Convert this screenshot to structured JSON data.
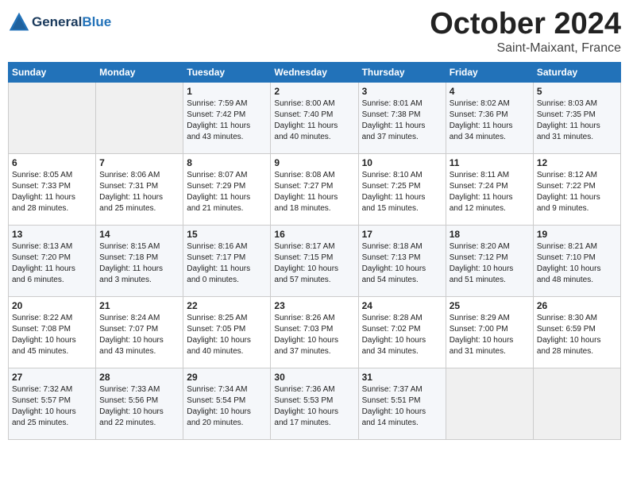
{
  "header": {
    "logo_line1": "General",
    "logo_line2": "Blue",
    "month": "October 2024",
    "location": "Saint-Maixant, France"
  },
  "weekdays": [
    "Sunday",
    "Monday",
    "Tuesday",
    "Wednesday",
    "Thursday",
    "Friday",
    "Saturday"
  ],
  "weeks": [
    [
      {
        "day": "",
        "info": ""
      },
      {
        "day": "",
        "info": ""
      },
      {
        "day": "1",
        "info": "Sunrise: 7:59 AM\nSunset: 7:42 PM\nDaylight: 11 hours\nand 43 minutes."
      },
      {
        "day": "2",
        "info": "Sunrise: 8:00 AM\nSunset: 7:40 PM\nDaylight: 11 hours\nand 40 minutes."
      },
      {
        "day": "3",
        "info": "Sunrise: 8:01 AM\nSunset: 7:38 PM\nDaylight: 11 hours\nand 37 minutes."
      },
      {
        "day": "4",
        "info": "Sunrise: 8:02 AM\nSunset: 7:36 PM\nDaylight: 11 hours\nand 34 minutes."
      },
      {
        "day": "5",
        "info": "Sunrise: 8:03 AM\nSunset: 7:35 PM\nDaylight: 11 hours\nand 31 minutes."
      }
    ],
    [
      {
        "day": "6",
        "info": "Sunrise: 8:05 AM\nSunset: 7:33 PM\nDaylight: 11 hours\nand 28 minutes."
      },
      {
        "day": "7",
        "info": "Sunrise: 8:06 AM\nSunset: 7:31 PM\nDaylight: 11 hours\nand 25 minutes."
      },
      {
        "day": "8",
        "info": "Sunrise: 8:07 AM\nSunset: 7:29 PM\nDaylight: 11 hours\nand 21 minutes."
      },
      {
        "day": "9",
        "info": "Sunrise: 8:08 AM\nSunset: 7:27 PM\nDaylight: 11 hours\nand 18 minutes."
      },
      {
        "day": "10",
        "info": "Sunrise: 8:10 AM\nSunset: 7:25 PM\nDaylight: 11 hours\nand 15 minutes."
      },
      {
        "day": "11",
        "info": "Sunrise: 8:11 AM\nSunset: 7:24 PM\nDaylight: 11 hours\nand 12 minutes."
      },
      {
        "day": "12",
        "info": "Sunrise: 8:12 AM\nSunset: 7:22 PM\nDaylight: 11 hours\nand 9 minutes."
      }
    ],
    [
      {
        "day": "13",
        "info": "Sunrise: 8:13 AM\nSunset: 7:20 PM\nDaylight: 11 hours\nand 6 minutes."
      },
      {
        "day": "14",
        "info": "Sunrise: 8:15 AM\nSunset: 7:18 PM\nDaylight: 11 hours\nand 3 minutes."
      },
      {
        "day": "15",
        "info": "Sunrise: 8:16 AM\nSunset: 7:17 PM\nDaylight: 11 hours\nand 0 minutes."
      },
      {
        "day": "16",
        "info": "Sunrise: 8:17 AM\nSunset: 7:15 PM\nDaylight: 10 hours\nand 57 minutes."
      },
      {
        "day": "17",
        "info": "Sunrise: 8:18 AM\nSunset: 7:13 PM\nDaylight: 10 hours\nand 54 minutes."
      },
      {
        "day": "18",
        "info": "Sunrise: 8:20 AM\nSunset: 7:12 PM\nDaylight: 10 hours\nand 51 minutes."
      },
      {
        "day": "19",
        "info": "Sunrise: 8:21 AM\nSunset: 7:10 PM\nDaylight: 10 hours\nand 48 minutes."
      }
    ],
    [
      {
        "day": "20",
        "info": "Sunrise: 8:22 AM\nSunset: 7:08 PM\nDaylight: 10 hours\nand 45 minutes."
      },
      {
        "day": "21",
        "info": "Sunrise: 8:24 AM\nSunset: 7:07 PM\nDaylight: 10 hours\nand 43 minutes."
      },
      {
        "day": "22",
        "info": "Sunrise: 8:25 AM\nSunset: 7:05 PM\nDaylight: 10 hours\nand 40 minutes."
      },
      {
        "day": "23",
        "info": "Sunrise: 8:26 AM\nSunset: 7:03 PM\nDaylight: 10 hours\nand 37 minutes."
      },
      {
        "day": "24",
        "info": "Sunrise: 8:28 AM\nSunset: 7:02 PM\nDaylight: 10 hours\nand 34 minutes."
      },
      {
        "day": "25",
        "info": "Sunrise: 8:29 AM\nSunset: 7:00 PM\nDaylight: 10 hours\nand 31 minutes."
      },
      {
        "day": "26",
        "info": "Sunrise: 8:30 AM\nSunset: 6:59 PM\nDaylight: 10 hours\nand 28 minutes."
      }
    ],
    [
      {
        "day": "27",
        "info": "Sunrise: 7:32 AM\nSunset: 5:57 PM\nDaylight: 10 hours\nand 25 minutes."
      },
      {
        "day": "28",
        "info": "Sunrise: 7:33 AM\nSunset: 5:56 PM\nDaylight: 10 hours\nand 22 minutes."
      },
      {
        "day": "29",
        "info": "Sunrise: 7:34 AM\nSunset: 5:54 PM\nDaylight: 10 hours\nand 20 minutes."
      },
      {
        "day": "30",
        "info": "Sunrise: 7:36 AM\nSunset: 5:53 PM\nDaylight: 10 hours\nand 17 minutes."
      },
      {
        "day": "31",
        "info": "Sunrise: 7:37 AM\nSunset: 5:51 PM\nDaylight: 10 hours\nand 14 minutes."
      },
      {
        "day": "",
        "info": ""
      },
      {
        "day": "",
        "info": ""
      }
    ]
  ]
}
